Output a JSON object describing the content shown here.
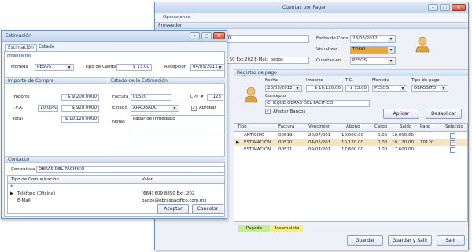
{
  "main": {
    "title": "Cuentas por Pagar",
    "menu": "Operaciones",
    "section_proveedor": "Proveedor",
    "proveedor_name_partial": "CO",
    "proveedor_addr_partial": "C 50 Ext.202  E-Mail: pagos",
    "fecha_corte_label": "Fecha de Corte",
    "fecha_corte_value": "28/03/2012",
    "visualizar_label": "Visualizar",
    "visualizar_value": "TODO",
    "cuentas_en_label": "Cuentas en",
    "cuentas_en_value": "PESOS",
    "registro_label": "Registro de pago",
    "fecha_label": "Fecha",
    "fecha_value": "28/03/2012",
    "importe_label": "Importe",
    "importe_value": "$ 10,120.00",
    "tc_label": "T.C.",
    "tc_value": "$ 13.00",
    "moneda_label": "Moneda",
    "moneda_value": "PESOS",
    "tipo_pago_label": "Tipo de pago",
    "tipo_pago_value": "DEPÓSITO",
    "concepto_label": "Concepto",
    "concepto_value": "CHEQUE OBRAS DEL PACIFICO",
    "afectar_label": "Afectar Bancos",
    "aplicar": "Aplicar",
    "desaplicar": "Desaplicar",
    "columns": [
      "Tipo",
      "Factura",
      "Vencimien",
      "Abono",
      "Cargo",
      "Saldo",
      "Pago",
      "Seleccio"
    ],
    "rows": [
      {
        "tipo": "ANTICIPO",
        "factura": "00519",
        "venc": "20/07/201",
        "abono": "10,000.00",
        "cargo": "0.00",
        "saldo": "10,000.00",
        "pago": "",
        "sel": ""
      },
      {
        "tipo": "ESTIMACIÓN",
        "factura": "00520",
        "venc": "04/05/201",
        "abono": "10,120.00",
        "cargo": "0.00",
        "saldo": "10,120.00",
        "pago": "10120",
        "sel": "✓"
      },
      {
        "tipo": "ESTIMACIÓN",
        "factura": "00521",
        "venc": "09/07/201",
        "abono": "17,600.00",
        "cargo": "0.00",
        "saldo": "17,600.00",
        "pago": "",
        "sel": ""
      }
    ],
    "status_pagado": "Pagado",
    "status_incompleto": "Incompleto",
    "guardar": "Guardar",
    "guardar_salir": "Guardar y Salir",
    "salir": "Salir"
  },
  "dialog": {
    "title": "Estimación",
    "tab_estimacion": "Estimación",
    "tab_estado": "Estado",
    "financieros": "Financieros",
    "moneda_label": "Moneda",
    "moneda_value": "PESOS",
    "tipo_cambio_label": "Tipo de Cambio",
    "tipo_cambio_value": "$ 13.00",
    "recepcion_label": "Recepción",
    "recepcion_value": "04/05/2011",
    "importe_compra": "Importe de Compra",
    "importe_label": "Importe",
    "importe_value": "$ 9,200.0000",
    "iva_label": "I.V.A.",
    "iva_pct": "10.00%",
    "iva_value": "$ 920.0000",
    "total_label": "Total",
    "total_value": "$ 10,120.0000",
    "estado_estimacion": "Estado de la Estimación",
    "factura_label": "Factura",
    "factura_value": "00520",
    "cpp_label": "CPP #",
    "cpp_value": "123",
    "estado_label": "Estado",
    "estado_value": "APROBADO",
    "aprobar_label": "Aprobar",
    "notas_label": "Notas",
    "notas_value": "Pagar de inmediato",
    "contacto": "Contacto",
    "contratista_label": "Contratista",
    "contratista_value": "OBRAS DEL PACIFICO",
    "col_tipo": "Tipo de Comunicación",
    "col_valor": "Valor",
    "comms": [
      {
        "tipo": "Teléfono (Oficina)",
        "valor": "(664) 609 8850 Ext. 202"
      },
      {
        "tipo": "E-Mail",
        "valor": "pagos@obraspacifico.com.mx"
      }
    ],
    "aceptar": "Aceptar",
    "cancelar": "Cancelar"
  }
}
